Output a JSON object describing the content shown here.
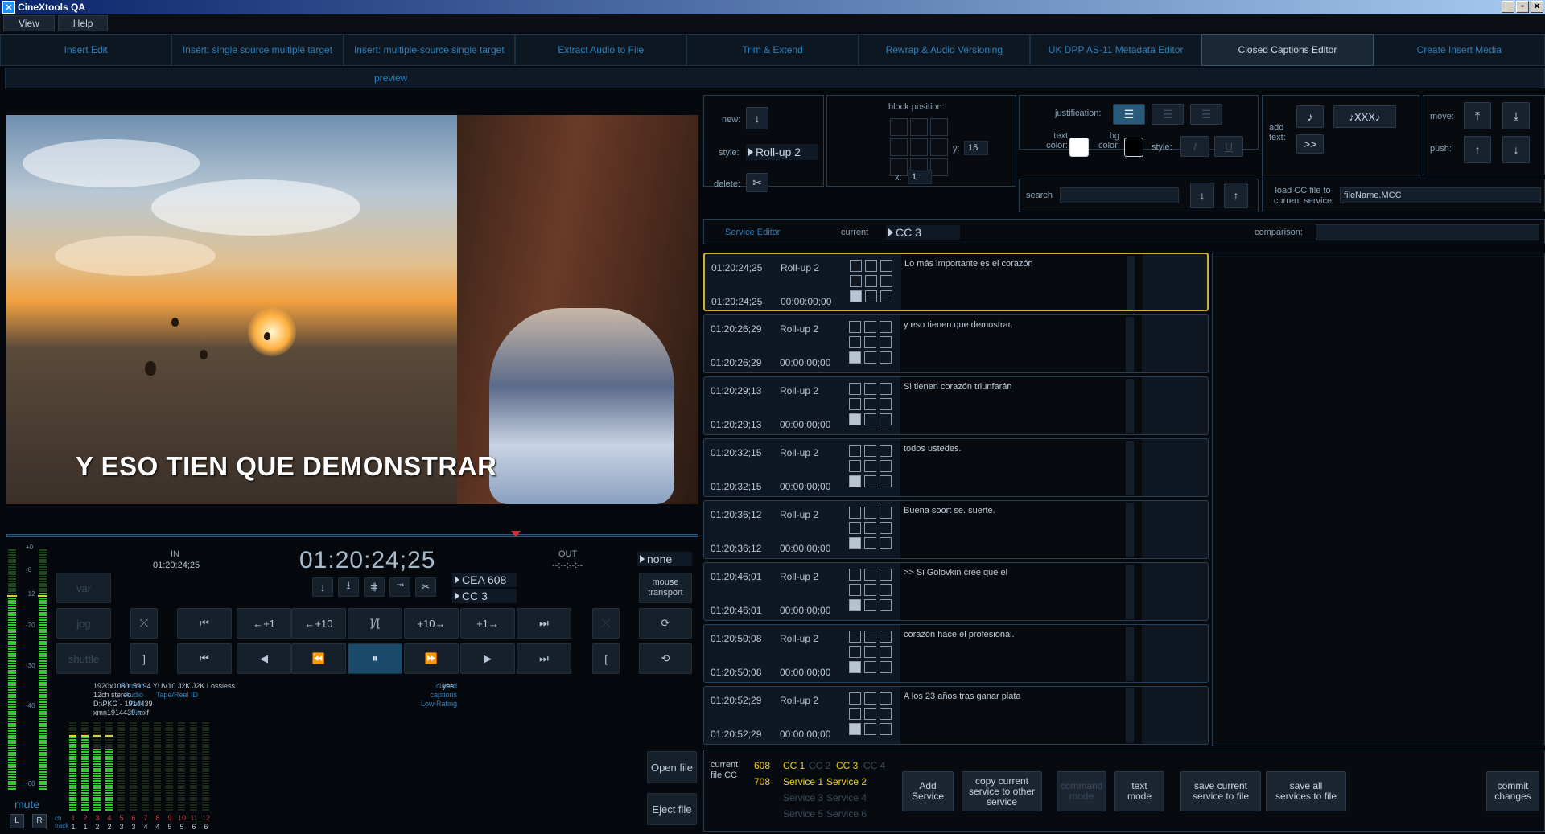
{
  "window": {
    "title": "CineXtools QA"
  },
  "menu": [
    "View",
    "Help"
  ],
  "tabs": [
    {
      "label": "Insert Edit"
    },
    {
      "label": "Insert: single source multiple target"
    },
    {
      "label": "Insert: multiple-source single target"
    },
    {
      "label": "Extract Audio to File"
    },
    {
      "label": "Trim & Extend"
    },
    {
      "label": "Rewrap & Audio Versioning"
    },
    {
      "label": "UK DPP AS-11 Metadata Editor"
    },
    {
      "label": "Closed Captions Editor",
      "active": true
    },
    {
      "label": "Create Insert Media"
    }
  ],
  "preview_label": "preview",
  "video": {
    "caption": "Y ESO TIEN QUE DEMONSTRAR"
  },
  "transport": {
    "in_label": "IN",
    "in_tc": "01:20:24;25",
    "out_label": "OUT",
    "out_tc": "--:--:--:--",
    "timecode": "01:20:24;25",
    "cc_standard": "CEA 608",
    "cc_channel": "CC 3",
    "none_label": "none",
    "mouse_transport": "mouse transport",
    "var": "var",
    "jog": "jog",
    "shuttle": "shuttle",
    "step_labels": [
      "+1",
      "+10",
      "+10",
      "+1"
    ],
    "open_file": "Open file",
    "eject_file": "Eject file",
    "mute": "mute",
    "L": "L",
    "R": "R",
    "ch": "ch",
    "track": "track"
  },
  "meter_scale": [
    "+0",
    "-6",
    "-12",
    "-20",
    "-30",
    "-40",
    "-60"
  ],
  "master_levels": [
    0.81,
    0.82
  ],
  "file_info": {
    "format_key": "Format",
    "format": "1920x1080i 59.94 YUV10 J2K J2K Lossless",
    "audio_key": "Audio",
    "audio": "12ch stereo",
    "tape_key": "Tape/Reel ID",
    "path_key": "Path",
    "path": "D:\\PKG - 1914439",
    "file_key": "File",
    "file": "xmn1914439.mxf",
    "cc_key": "closed captions",
    "cc_val": "yes",
    "low_rating": "Low Rating"
  },
  "channels": {
    "numbers": [
      "1",
      "2",
      "3",
      "4",
      "5",
      "6",
      "7",
      "8",
      "9",
      "10",
      "11",
      "12"
    ],
    "tracks": [
      "1",
      "1",
      "2",
      "2",
      "3",
      "3",
      "4",
      "4",
      "5",
      "5",
      "6",
      "6"
    ],
    "levels": [
      0.82,
      0.82,
      0.7,
      0.7,
      0,
      0,
      0,
      0,
      0,
      0,
      0,
      0
    ]
  },
  "editor": {
    "new_label": "new:",
    "style_label": "style:",
    "style_value": "Roll-up 2",
    "delete_label": "delete:",
    "block_position": "block position:",
    "y_label": "y:",
    "y_value": "15",
    "x_label": "x:",
    "x_value": "1",
    "justification": "justification:",
    "text_color": "text color:",
    "bg_color": "bg color:",
    "style2": "style:",
    "add_text": "add text:",
    "music_single": "♪",
    "music_xxx": "♪XXX♪",
    "more": ">>",
    "move": "move:",
    "push": "push:",
    "search": "search",
    "load_cc": "load CC file to current service",
    "load_value": "fileName.MCC",
    "service_editor": "Service Editor",
    "current": "current",
    "current_value": "CC 3",
    "comparison": "comparison:"
  },
  "captions": [
    {
      "tc": "01:20:24;25",
      "style": "Roll-up 2",
      "dur": "00:00:00;00",
      "text": "Lo más importante es el corazón",
      "selected": true
    },
    {
      "tc": "01:20:26;29",
      "style": "Roll-up 2",
      "dur": "00:00:00;00",
      "text": "y eso tienen que demostrar."
    },
    {
      "tc": "01:20:29;13",
      "style": "Roll-up 2",
      "dur": "00:00:00;00",
      "text": "Si tienen corazón triunfarán"
    },
    {
      "tc": "01:20:32;15",
      "style": "Roll-up 2",
      "dur": "00:00:00;00",
      "text": "todos ustedes."
    },
    {
      "tc": "01:20:36;12",
      "style": "Roll-up 2",
      "dur": "00:00:00;00",
      "text": "Buena soort se.  suerte."
    },
    {
      "tc": "01:20:46;01",
      "style": "Roll-up 2",
      "dur": "00:00:00;00",
      "text": ">> Si Golovkin cree que el"
    },
    {
      "tc": "01:20:50;08",
      "style": "Roll-up 2",
      "dur": "00:00:00;00",
      "text": "corazón hace el profesional."
    },
    {
      "tc": "01:20:52;29",
      "style": "Roll-up 2",
      "dur": "00:00:00;00",
      "text": "A los 23 años tras ganar plata"
    }
  ],
  "services": {
    "current_file_cc": "current file CC",
    "s608": "608",
    "s708": "708",
    "cc": [
      "CC 1",
      "CC 2",
      "CC 3",
      "CC 4"
    ],
    "svc": [
      "Service 1",
      "Service 2",
      "Service 3",
      "Service 4",
      "Service 5",
      "Service 6"
    ]
  },
  "bottom_buttons": {
    "add_service": "Add Service",
    "copy": "copy current service to other service",
    "command_mode": "command mode",
    "text_mode": "text mode",
    "save_current": "save current service to file",
    "save_all": "save all services to file",
    "commit": "commit changes"
  },
  "colors": {
    "accent": "#2f7fb8",
    "highlight": "#d0b030",
    "active_tab": "#1a2836",
    "service_yellow": "#f0d020"
  }
}
